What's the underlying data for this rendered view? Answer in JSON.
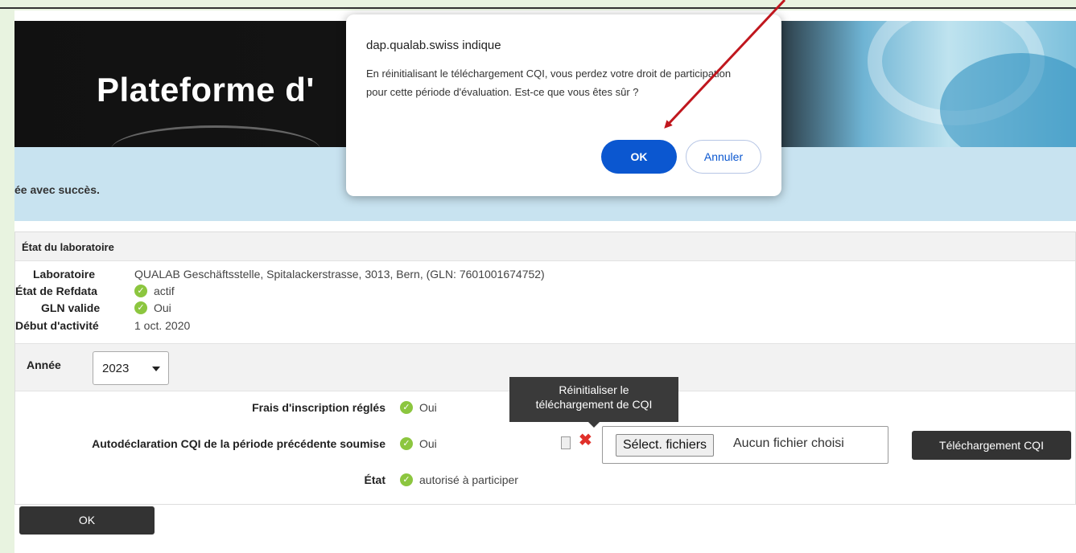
{
  "banner": {
    "title": "Plateforme d'"
  },
  "success": {
    "text": "ée avec succès."
  },
  "lab": {
    "header": "État du laboratoire",
    "fields": [
      {
        "key": "Laboratoire",
        "value": "QUALAB Geschäftsstelle, Spitalackerstrasse, 3013, Bern, (GLN: 7601001674752)",
        "check": false
      },
      {
        "key": "État de Refdata",
        "value": "actif",
        "check": true
      },
      {
        "key": "GLN valide",
        "value": "Oui",
        "check": true
      },
      {
        "key": "Début d'activité",
        "value": "1 oct. 2020",
        "check": false
      }
    ]
  },
  "year": {
    "label": "Année",
    "selected": "2023"
  },
  "rows": [
    {
      "label": "Frais d'inscription réglés",
      "value": "Oui"
    },
    {
      "label": "Autodéclaration CQI de la période précédente soumise",
      "value": "Oui"
    },
    {
      "label": "État",
      "value": "autorisé à participer"
    }
  ],
  "tooltip": {
    "line1": "Réinitialiser le",
    "line2": "téléchargement de CQI"
  },
  "file": {
    "button": "Sélect. fichiers",
    "status": "Aucun fichier choisi"
  },
  "upload_button": "Téléchargement CQI",
  "ok_button": "OK",
  "dialog": {
    "title": "dap.qualab.swiss indique",
    "message": "En réinitialisant le téléchargement CQI, vous perdez votre droit de participation pour cette période d'évaluation. Est-ce que vous êtes sûr ?",
    "ok": "OK",
    "cancel": "Annuler"
  },
  "colors": {
    "accent": "#0b57d0",
    "check": "#8cc63f",
    "delete": "#e0302a",
    "annotation": "#c0171e"
  }
}
